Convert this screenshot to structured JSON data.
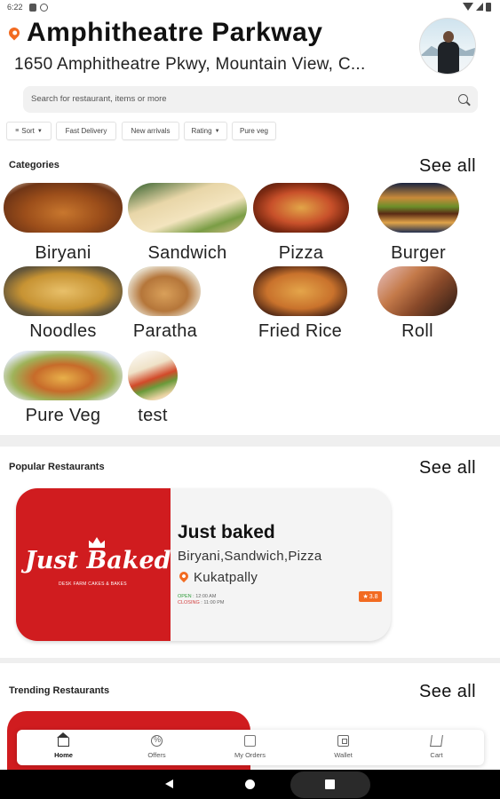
{
  "status_bar": {
    "time": "6:22"
  },
  "header": {
    "location_title": "Amphitheatre Parkway",
    "location_address": "1650 Amphitheatre Pkwy, Mountain View, C..."
  },
  "search": {
    "placeholder": "Search for restaurant, items or more"
  },
  "filters": [
    "Sort",
    "Fast Delivery",
    "New arrivals",
    "Rating",
    "Pure veg"
  ],
  "categories": {
    "title": "Categories",
    "see_all": "See all",
    "items": [
      "Biryani",
      "Sandwich",
      "Pizza",
      "Burger",
      "Noodles",
      "Paratha",
      "Fried Rice",
      "Roll",
      "Pure Veg",
      "test"
    ]
  },
  "popular": {
    "title": "Popular Restaurants",
    "see_all": "See all",
    "restaurant": {
      "name": "Just baked",
      "logo_text": "Just Baked",
      "logo_tagline": "DESK FARM CAKES & BAKES",
      "cuisines": "Biryani,Sandwich,Pizza",
      "location": "Kukatpally",
      "open_label": "OPEN",
      "open_time": "12:00 AM",
      "closing_label": "CLOSING",
      "closing_time": "11:00 PM",
      "rating": "3.8"
    }
  },
  "trending": {
    "title": "Trending Restaurants",
    "see_all": "See all"
  },
  "bottom_nav": [
    "Home",
    "Offers",
    "My Orders",
    "Wallet",
    "Cart"
  ],
  "colors": {
    "accent": "#f26b21",
    "brand_red": "#d01c1f"
  }
}
